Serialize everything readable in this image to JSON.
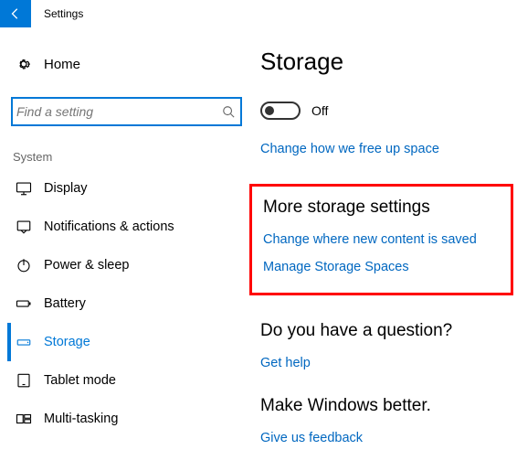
{
  "app_title": "Settings",
  "home_label": "Home",
  "search": {
    "placeholder": "Find a setting"
  },
  "section_label": "System",
  "nav": [
    {
      "label": "Display"
    },
    {
      "label": "Notifications & actions"
    },
    {
      "label": "Power & sleep"
    },
    {
      "label": "Battery"
    },
    {
      "label": "Storage"
    },
    {
      "label": "Tablet mode"
    },
    {
      "label": "Multi-tasking"
    }
  ],
  "main": {
    "heading": "Storage",
    "toggle_state": "Off",
    "link_change_free": "Change how we free up space",
    "more_settings": {
      "heading": "More storage settings",
      "link_new_content": "Change where new content is saved",
      "link_manage_spaces": "Manage Storage Spaces"
    },
    "question": {
      "heading": "Do you have a question?",
      "link": "Get help"
    },
    "feedback": {
      "heading": "Make Windows better.",
      "link": "Give us feedback"
    }
  }
}
